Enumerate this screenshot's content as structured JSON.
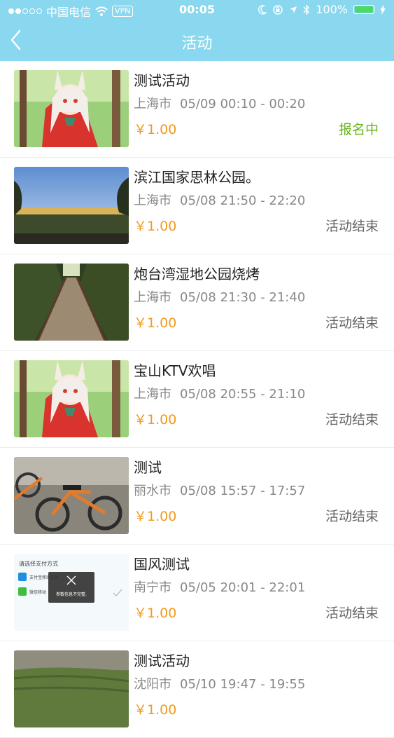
{
  "status_bar": {
    "carrier": "中国电信",
    "vpn": "VPN",
    "time": "00:05",
    "battery": "100%"
  },
  "header": {
    "title": "活动"
  },
  "activities": [
    {
      "name": "测试活动",
      "city": "上海市",
      "time": "05/09 00:10 - 00:20",
      "price": "￥1.00",
      "status": "报名中",
      "thumb": "anime"
    },
    {
      "name": "滨江国家思林公园。",
      "city": "上海市",
      "time": "05/08 21:50 - 22:20",
      "price": "￥1.00",
      "status": "活动结束",
      "thumb": "park"
    },
    {
      "name": "炮台湾湿地公园烧烤",
      "city": "上海市",
      "time": "05/08 21:30 - 21:40",
      "price": "￥1.00",
      "status": "活动结束",
      "thumb": "boardwalk"
    },
    {
      "name": "宝山KTV欢唱",
      "city": "上海市",
      "time": "05/08 20:55 - 21:10",
      "price": "￥1.00",
      "status": "活动结束",
      "thumb": "anime"
    },
    {
      "name": "测试",
      "city": "丽水市",
      "time": "05/08 15:57 - 17:57",
      "price": "￥1.00",
      "status": "活动结束",
      "thumb": "bikes"
    },
    {
      "name": "国风测试",
      "city": "南宁市",
      "time": "05/05 20:01 - 22:01",
      "price": "￥1.00",
      "status": "活动结束",
      "thumb": "screenshot",
      "thumb_text": {
        "heading": "请选择支付方式",
        "alipay": "支付宝移动支付",
        "wechat": "微信移动",
        "toast": "参数信息不完整."
      }
    },
    {
      "name": "测试活动",
      "city": "沈阳市",
      "time": "05/10 19:47 - 19:55",
      "price": "￥1.00",
      "status": "",
      "thumb": "grass"
    }
  ],
  "colors": {
    "header_bg": "#8ad8ef",
    "price": "#f39a1c",
    "status_active": "#66b316",
    "status_ended": "#666666"
  }
}
